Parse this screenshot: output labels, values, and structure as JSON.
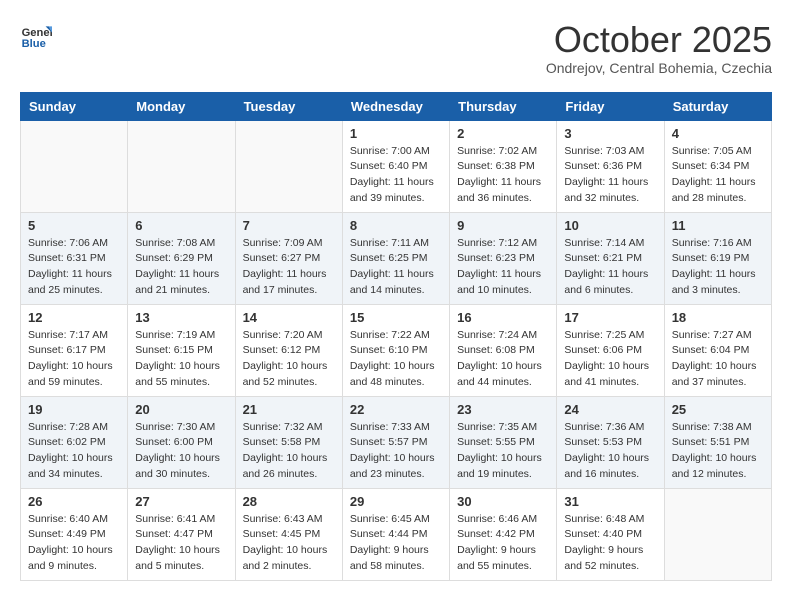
{
  "header": {
    "logo_line1": "General",
    "logo_line2": "Blue",
    "month": "October 2025",
    "location": "Ondrejov, Central Bohemia, Czechia"
  },
  "weekdays": [
    "Sunday",
    "Monday",
    "Tuesday",
    "Wednesday",
    "Thursday",
    "Friday",
    "Saturday"
  ],
  "weeks": [
    [
      {
        "day": "",
        "sunrise": "",
        "sunset": "",
        "daylight": ""
      },
      {
        "day": "",
        "sunrise": "",
        "sunset": "",
        "daylight": ""
      },
      {
        "day": "",
        "sunrise": "",
        "sunset": "",
        "daylight": ""
      },
      {
        "day": "1",
        "sunrise": "Sunrise: 7:00 AM",
        "sunset": "Sunset: 6:40 PM",
        "daylight": "Daylight: 11 hours and 39 minutes."
      },
      {
        "day": "2",
        "sunrise": "Sunrise: 7:02 AM",
        "sunset": "Sunset: 6:38 PM",
        "daylight": "Daylight: 11 hours and 36 minutes."
      },
      {
        "day": "3",
        "sunrise": "Sunrise: 7:03 AM",
        "sunset": "Sunset: 6:36 PM",
        "daylight": "Daylight: 11 hours and 32 minutes."
      },
      {
        "day": "4",
        "sunrise": "Sunrise: 7:05 AM",
        "sunset": "Sunset: 6:34 PM",
        "daylight": "Daylight: 11 hours and 28 minutes."
      }
    ],
    [
      {
        "day": "5",
        "sunrise": "Sunrise: 7:06 AM",
        "sunset": "Sunset: 6:31 PM",
        "daylight": "Daylight: 11 hours and 25 minutes."
      },
      {
        "day": "6",
        "sunrise": "Sunrise: 7:08 AM",
        "sunset": "Sunset: 6:29 PM",
        "daylight": "Daylight: 11 hours and 21 minutes."
      },
      {
        "day": "7",
        "sunrise": "Sunrise: 7:09 AM",
        "sunset": "Sunset: 6:27 PM",
        "daylight": "Daylight: 11 hours and 17 minutes."
      },
      {
        "day": "8",
        "sunrise": "Sunrise: 7:11 AM",
        "sunset": "Sunset: 6:25 PM",
        "daylight": "Daylight: 11 hours and 14 minutes."
      },
      {
        "day": "9",
        "sunrise": "Sunrise: 7:12 AM",
        "sunset": "Sunset: 6:23 PM",
        "daylight": "Daylight: 11 hours and 10 minutes."
      },
      {
        "day": "10",
        "sunrise": "Sunrise: 7:14 AM",
        "sunset": "Sunset: 6:21 PM",
        "daylight": "Daylight: 11 hours and 6 minutes."
      },
      {
        "day": "11",
        "sunrise": "Sunrise: 7:16 AM",
        "sunset": "Sunset: 6:19 PM",
        "daylight": "Daylight: 11 hours and 3 minutes."
      }
    ],
    [
      {
        "day": "12",
        "sunrise": "Sunrise: 7:17 AM",
        "sunset": "Sunset: 6:17 PM",
        "daylight": "Daylight: 10 hours and 59 minutes."
      },
      {
        "day": "13",
        "sunrise": "Sunrise: 7:19 AM",
        "sunset": "Sunset: 6:15 PM",
        "daylight": "Daylight: 10 hours and 55 minutes."
      },
      {
        "day": "14",
        "sunrise": "Sunrise: 7:20 AM",
        "sunset": "Sunset: 6:12 PM",
        "daylight": "Daylight: 10 hours and 52 minutes."
      },
      {
        "day": "15",
        "sunrise": "Sunrise: 7:22 AM",
        "sunset": "Sunset: 6:10 PM",
        "daylight": "Daylight: 10 hours and 48 minutes."
      },
      {
        "day": "16",
        "sunrise": "Sunrise: 7:24 AM",
        "sunset": "Sunset: 6:08 PM",
        "daylight": "Daylight: 10 hours and 44 minutes."
      },
      {
        "day": "17",
        "sunrise": "Sunrise: 7:25 AM",
        "sunset": "Sunset: 6:06 PM",
        "daylight": "Daylight: 10 hours and 41 minutes."
      },
      {
        "day": "18",
        "sunrise": "Sunrise: 7:27 AM",
        "sunset": "Sunset: 6:04 PM",
        "daylight": "Daylight: 10 hours and 37 minutes."
      }
    ],
    [
      {
        "day": "19",
        "sunrise": "Sunrise: 7:28 AM",
        "sunset": "Sunset: 6:02 PM",
        "daylight": "Daylight: 10 hours and 34 minutes."
      },
      {
        "day": "20",
        "sunrise": "Sunrise: 7:30 AM",
        "sunset": "Sunset: 6:00 PM",
        "daylight": "Daylight: 10 hours and 30 minutes."
      },
      {
        "day": "21",
        "sunrise": "Sunrise: 7:32 AM",
        "sunset": "Sunset: 5:58 PM",
        "daylight": "Daylight: 10 hours and 26 minutes."
      },
      {
        "day": "22",
        "sunrise": "Sunrise: 7:33 AM",
        "sunset": "Sunset: 5:57 PM",
        "daylight": "Daylight: 10 hours and 23 minutes."
      },
      {
        "day": "23",
        "sunrise": "Sunrise: 7:35 AM",
        "sunset": "Sunset: 5:55 PM",
        "daylight": "Daylight: 10 hours and 19 minutes."
      },
      {
        "day": "24",
        "sunrise": "Sunrise: 7:36 AM",
        "sunset": "Sunset: 5:53 PM",
        "daylight": "Daylight: 10 hours and 16 minutes."
      },
      {
        "day": "25",
        "sunrise": "Sunrise: 7:38 AM",
        "sunset": "Sunset: 5:51 PM",
        "daylight": "Daylight: 10 hours and 12 minutes."
      }
    ],
    [
      {
        "day": "26",
        "sunrise": "Sunrise: 6:40 AM",
        "sunset": "Sunset: 4:49 PM",
        "daylight": "Daylight: 10 hours and 9 minutes."
      },
      {
        "day": "27",
        "sunrise": "Sunrise: 6:41 AM",
        "sunset": "Sunset: 4:47 PM",
        "daylight": "Daylight: 10 hours and 5 minutes."
      },
      {
        "day": "28",
        "sunrise": "Sunrise: 6:43 AM",
        "sunset": "Sunset: 4:45 PM",
        "daylight": "Daylight: 10 hours and 2 minutes."
      },
      {
        "day": "29",
        "sunrise": "Sunrise: 6:45 AM",
        "sunset": "Sunset: 4:44 PM",
        "daylight": "Daylight: 9 hours and 58 minutes."
      },
      {
        "day": "30",
        "sunrise": "Sunrise: 6:46 AM",
        "sunset": "Sunset: 4:42 PM",
        "daylight": "Daylight: 9 hours and 55 minutes."
      },
      {
        "day": "31",
        "sunrise": "Sunrise: 6:48 AM",
        "sunset": "Sunset: 4:40 PM",
        "daylight": "Daylight: 9 hours and 52 minutes."
      },
      {
        "day": "",
        "sunrise": "",
        "sunset": "",
        "daylight": ""
      }
    ]
  ]
}
